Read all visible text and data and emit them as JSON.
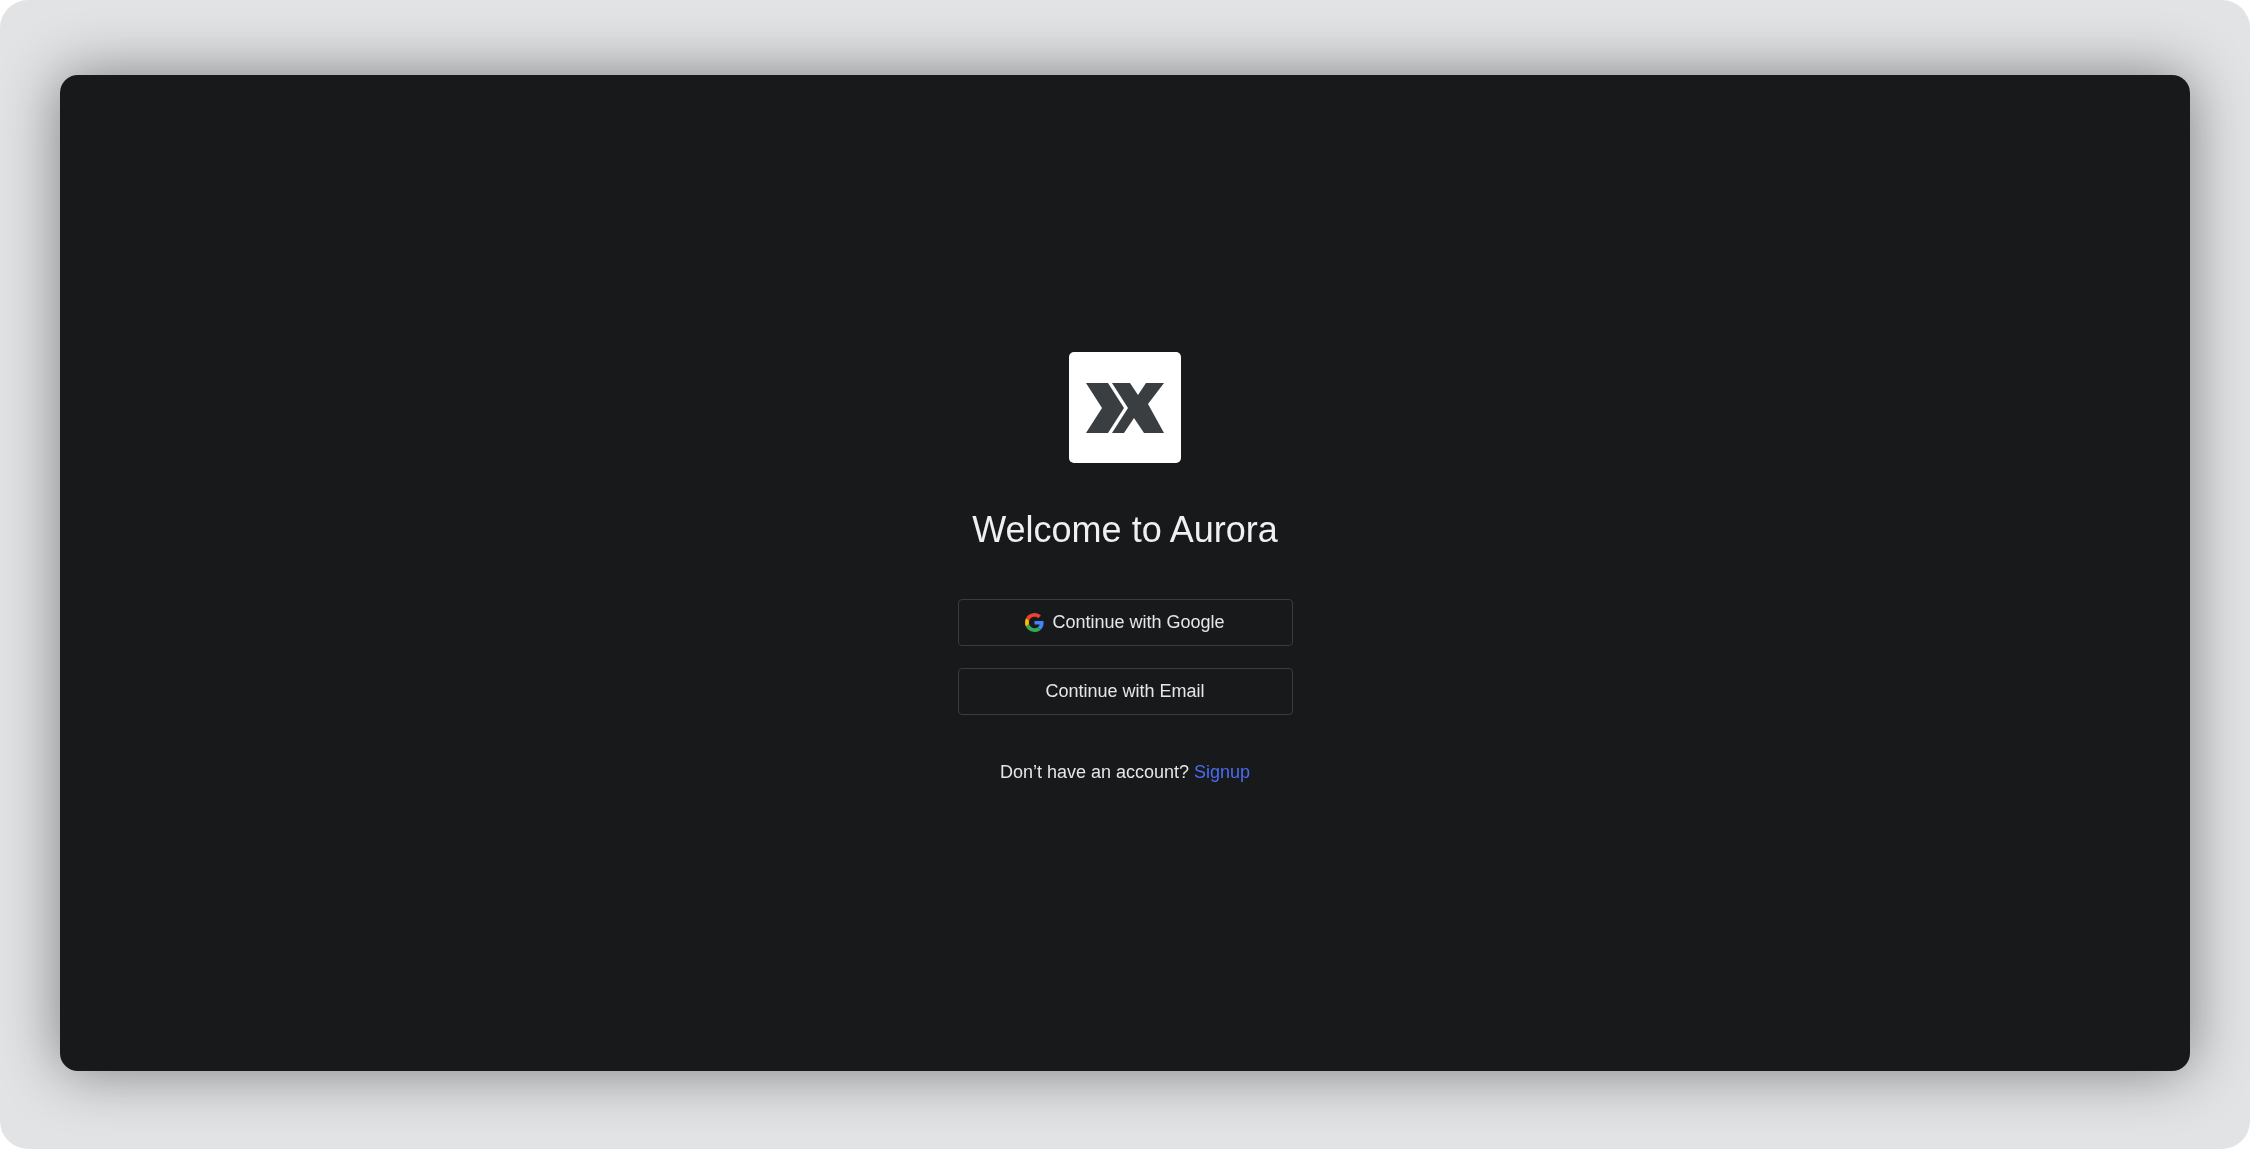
{
  "title": "Welcome to Aurora",
  "buttons": [
    {
      "kind": "google",
      "label": "Continue with Google"
    },
    {
      "kind": "email",
      "label": "Continue with Email"
    }
  ],
  "footer": {
    "text": "Don’t have an account?",
    "link": "Signup"
  }
}
